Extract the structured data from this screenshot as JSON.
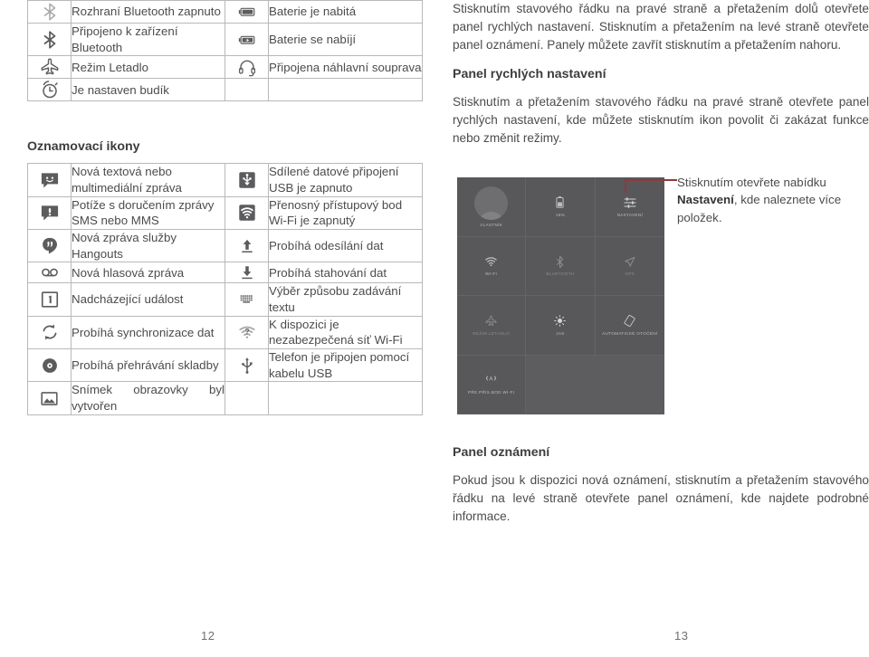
{
  "left_page": {
    "status_icons_table": {
      "rows": [
        {
          "left": {
            "icon": "bluetooth-on-icon",
            "text": "Rozhraní Bluetooth zapnuto"
          },
          "right": {
            "icon": "battery-full-icon",
            "text": "Baterie je nabitá"
          }
        },
        {
          "left": {
            "icon": "bluetooth-connected-icon",
            "text": "Připojeno k zařízení Bluetooth"
          },
          "right": {
            "icon": "battery-charging-icon",
            "text": "Baterie se nabíjí"
          }
        },
        {
          "left": {
            "icon": "airplane-icon",
            "text": "Režim Letadlo"
          },
          "right": {
            "icon": "headset-icon",
            "text": "Připojena náhlavní souprava"
          }
        },
        {
          "left": {
            "icon": "alarm-clock-icon",
            "text": "Je nastaven budík"
          },
          "right": {
            "icon": "",
            "text": ""
          }
        }
      ]
    },
    "notification_heading": "Oznamovací ikony",
    "notification_icons_table": {
      "rows": [
        {
          "left": {
            "icon": "sms-message-icon",
            "text": "Nová textová nebo multimediální zpráva"
          },
          "right": {
            "icon": "usb-tether-icon",
            "text": "Sdílené datové připojení USB je zapnuto"
          }
        },
        {
          "left": {
            "icon": "message-problem-icon",
            "text": "Potíže s doručením zprávy SMS nebo MMS"
          },
          "right": {
            "icon": "wifi-hotspot-icon",
            "text": "Přenosný přístupový bod Wi-Fi je zapnutý"
          }
        },
        {
          "left": {
            "icon": "hangouts-icon",
            "text": "Nová zpráva služby Hangouts"
          },
          "right": {
            "icon": "upload-icon",
            "text": "Probíhá odesílání dat"
          }
        },
        {
          "left": {
            "icon": "voicemail-icon",
            "text": "Nová hlasová zpráva"
          },
          "right": {
            "icon": "download-icon",
            "text": "Probíhá stahování dat"
          }
        },
        {
          "left": {
            "icon": "calendar-event-icon",
            "text": "Nadcházející událost"
          },
          "right": {
            "icon": "keyboard-icon",
            "text": "Výběr způsobu zadávání textu"
          }
        },
        {
          "left": {
            "icon": "sync-icon",
            "text": "Probíhá synchronizace dat"
          },
          "right": {
            "icon": "wifi-open-network-icon",
            "text": "K dispozici je nezabezpečená síť Wi-Fi"
          }
        },
        {
          "left": {
            "icon": "music-playing-icon",
            "text": "Probíhá přehrávání skladby"
          },
          "right": {
            "icon": "usb-connected-icon",
            "text": "Telefon je připojen pomocí kabelu USB"
          }
        },
        {
          "left": {
            "icon": "screenshot-icon",
            "text": "Snímek obrazovky byl vytvořen"
          },
          "right": {
            "icon": "",
            "text": ""
          }
        }
      ]
    },
    "page_number": "12"
  },
  "right_page": {
    "intro_paragraph": "Stisknutím stavového řádku na pravé straně a přetažením dolů otevřete panel rychlých nastavení. Stisknutím a přetažením na levé straně otevřete panel oznámení. Panely můžete zavřít stisknutím a přetažením nahoru.",
    "quick_settings_heading": "Panel rychlých nastavení",
    "quick_settings_paragraph": "Stisknutím a přetažením stavového řádku na pravé straně otevřete panel rychlých nastavení, kde můžete stisknutím ikon povolit či zakázat funkce nebo změnit režimy.",
    "callout": {
      "text_before": "Stisknutím otevřete nabídku ",
      "bold": "Nastavení",
      "text_after": ", kde naleznete více položek.",
      "line_color": "#8e3a3f"
    },
    "quick_settings_panel": {
      "tiles": [
        {
          "icon": "owner-avatar-icon",
          "label": "VLASTNÍK",
          "value": ""
        },
        {
          "icon": "battery-icon",
          "label": "16%",
          "value": "16%"
        },
        {
          "icon": "settings-sliders-icon",
          "label": "NASTAVENÍ",
          "value": ""
        },
        {
          "icon": "wifi-icon",
          "label": "WI-FI",
          "value": ""
        },
        {
          "icon": "bluetooth-icon",
          "label": "BLUETOOTH",
          "value": ""
        },
        {
          "icon": "gps-icon",
          "label": "GPS",
          "value": ""
        },
        {
          "icon": "airplane-icon",
          "label": "REŽIM LETADLO",
          "value": ""
        },
        {
          "icon": "brightness-icon",
          "label": "JAS",
          "value": ""
        },
        {
          "icon": "auto-rotate-icon",
          "label": "AUTOMATICKÉ OTOČENÍ",
          "value": ""
        },
        {
          "icon": "hotspot-icon",
          "label": "PŘE.PŘÍS.BOD WI-FI",
          "value": ""
        }
      ]
    },
    "notification_panel_heading": "Panel oznámení",
    "notification_panel_paragraph": "Pokud jsou k dispozici nová oznámení, stisknutím a přetažením stavového řádku na levé straně otevřete panel oznámení, kde najdete podrobné informace.",
    "page_number": "13"
  }
}
